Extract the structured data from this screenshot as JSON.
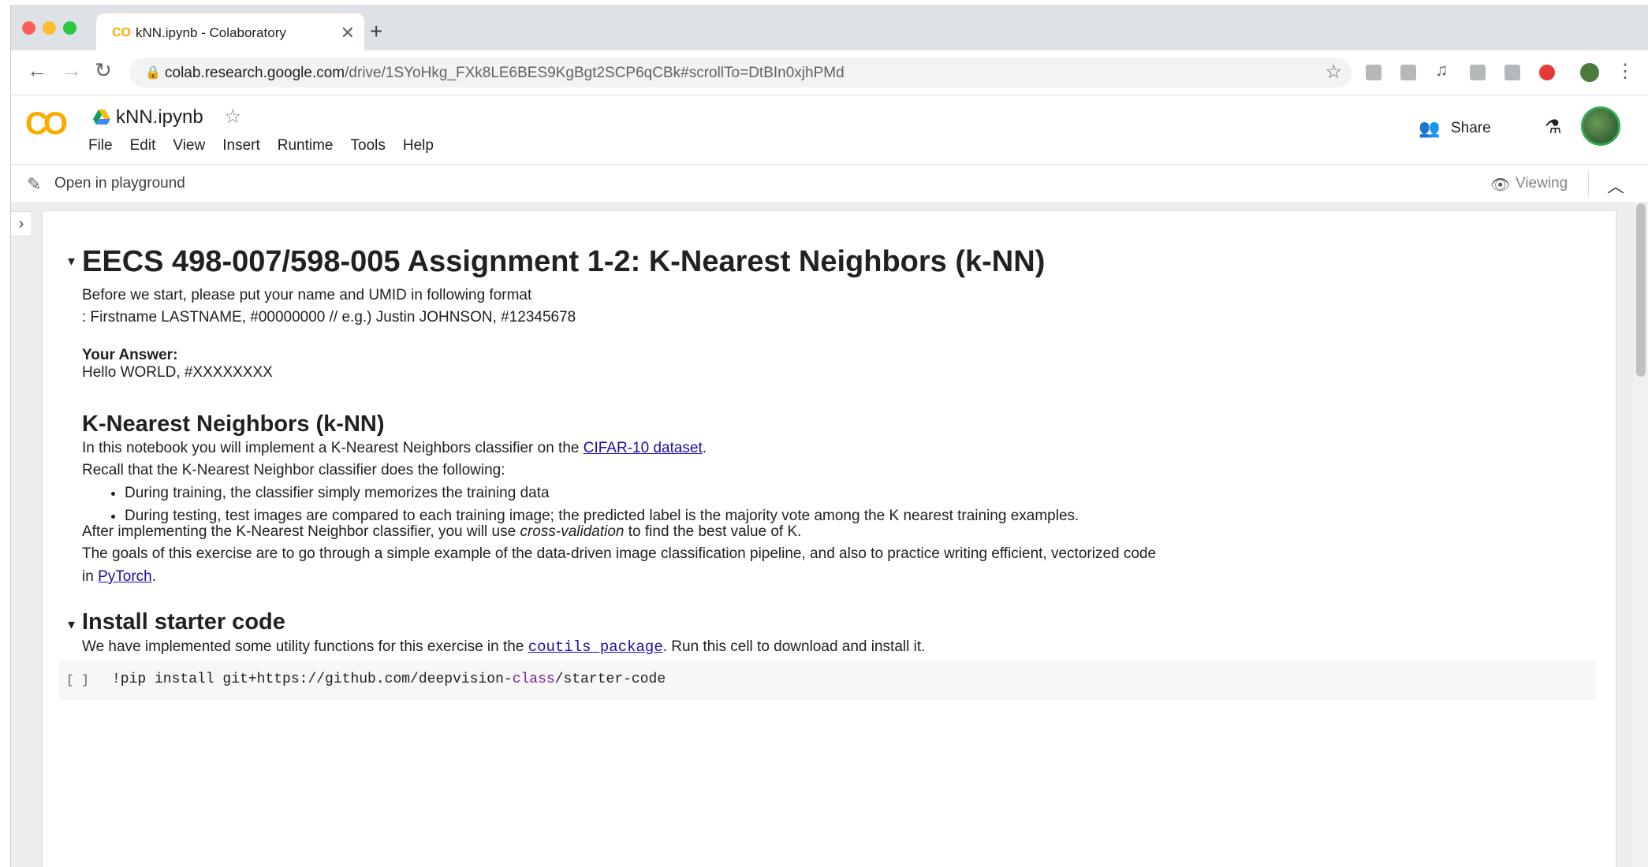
{
  "browser": {
    "tab_title": "kNN.ipynb - Colaboratory",
    "tab_icon": "CO",
    "url_domain": "colab.research.google.com",
    "url_path": "/drive/1SYoHkg_FXk8LE6BES9KgBgt2SCP6qCBk#scrollTo=DtBIn0xjhPMd",
    "colors": {
      "close": "#ff5f57",
      "minimize": "#febc2e",
      "maximize": "#28c840"
    }
  },
  "colab": {
    "logo": "CO",
    "notebook_title": "kNN.ipynb",
    "menu": [
      "File",
      "Edit",
      "View",
      "Insert",
      "Runtime",
      "Tools",
      "Help"
    ],
    "share_label": "Share",
    "playground_label": "Open in playground",
    "viewing_label": "Viewing"
  },
  "notebook": {
    "title": "EECS 498-007/598-005 Assignment 1-2: K-Nearest Neighbors (k-NN)",
    "intro1": "Before we start, please put your name and UMID in following format",
    "intro2": ": Firstname LASTNAME, #00000000 // e.g.) Justin JOHNSON, #12345678",
    "answer_label": "Your Answer:",
    "answer_value": "Hello WORLD, #XXXXXXXX",
    "section1_title": "K-Nearest Neighbors (k-NN)",
    "s1_p1_pre": "In this notebook you will implement a K-Nearest Neighbors classifier on the ",
    "s1_p1_link": "CIFAR-10 dataset",
    "s1_p1_post": ".",
    "s1_p2": "Recall that the K-Nearest Neighbor classifier does the following:",
    "bullets": [
      "During training, the classifier simply memorizes the training data",
      "During testing, test images are compared to each training image; the predicted label is the majority vote among the K nearest training examples."
    ],
    "s1_p3_pre": "After implementing the K-Nearest Neighbor classifier, you will use ",
    "s1_p3_em": "cross-validation",
    "s1_p3_post": " to find the best value of K.",
    "s1_p4_line1": "The goals of this exercise are to go through a simple example of the data-driven image classification pipeline, and also to practice writing efficient, vectorized code",
    "s1_p4_pre": "in ",
    "s1_p4_link": "PyTorch",
    "s1_p4_post": ".",
    "section2_title": "Install starter code",
    "s2_p1_pre": "We have implemented some utility functions for this exercise in the ",
    "s2_p1_link": "coutils package",
    "s2_p1_post": ". Run this cell to download and install it.",
    "code_cell_status": "[ ]",
    "code_pre": "!pip install git+https://github.com/deepvision-",
    "code_kw": "class",
    "code_post": "/starter-code"
  }
}
